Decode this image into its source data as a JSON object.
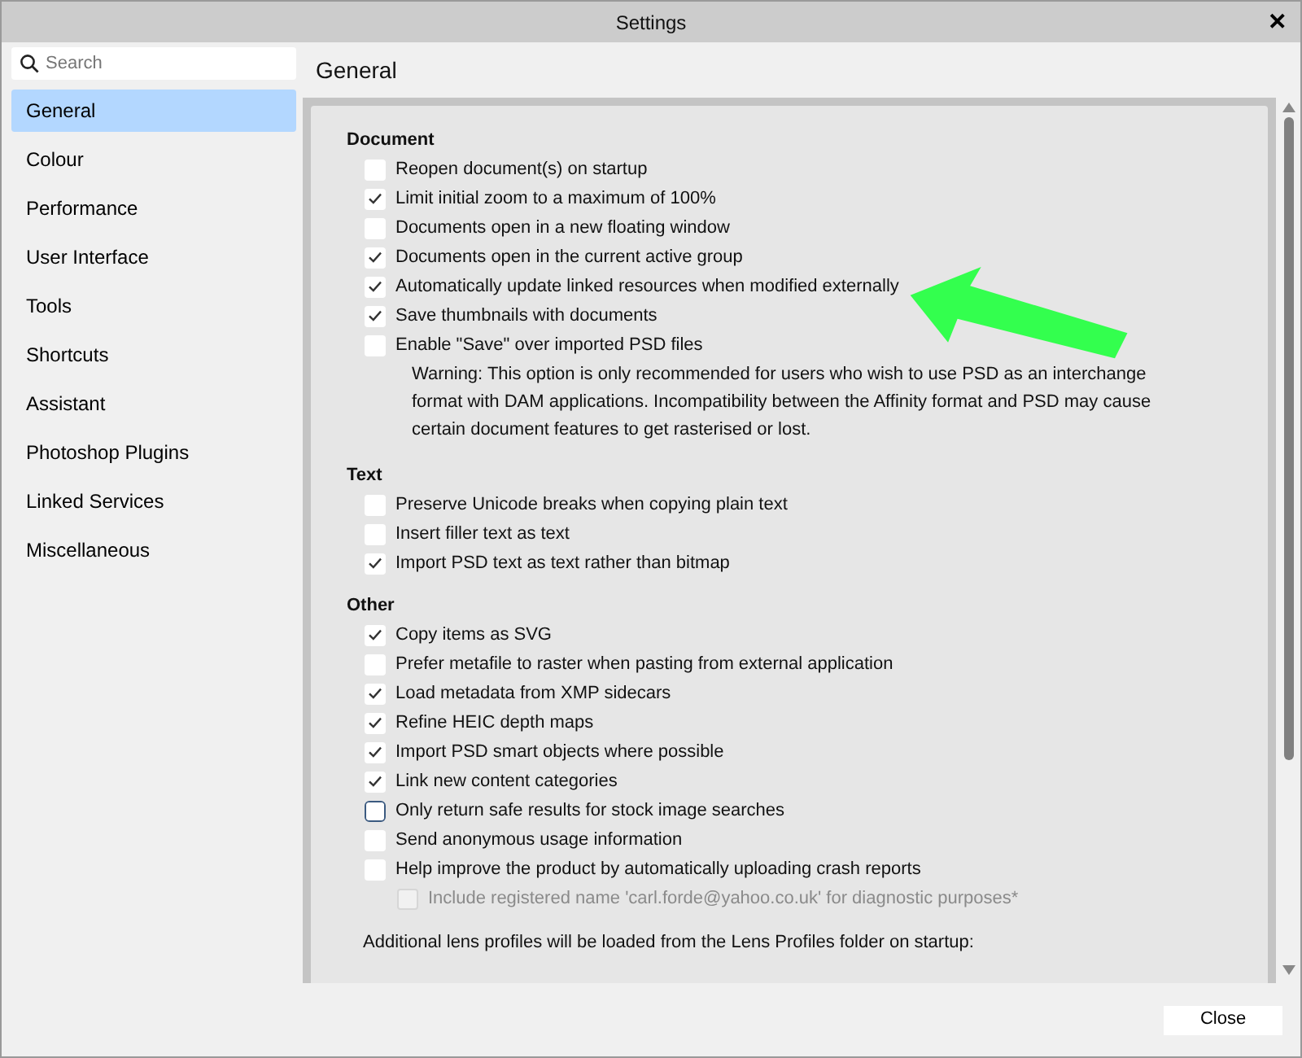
{
  "window": {
    "title": "Settings",
    "close_label": "✕"
  },
  "sidebar": {
    "search": {
      "placeholder": "Search"
    },
    "items": [
      {
        "label": "General",
        "selected": true
      },
      {
        "label": "Colour",
        "selected": false
      },
      {
        "label": "Performance",
        "selected": false
      },
      {
        "label": "User Interface",
        "selected": false
      },
      {
        "label": "Tools",
        "selected": false
      },
      {
        "label": "Shortcuts",
        "selected": false
      },
      {
        "label": "Assistant",
        "selected": false
      },
      {
        "label": "Photoshop Plugins",
        "selected": false
      },
      {
        "label": "Linked Services",
        "selected": false
      },
      {
        "label": "Miscellaneous",
        "selected": false
      }
    ]
  },
  "page": {
    "title": "General",
    "sections": [
      {
        "heading": "Document",
        "items": [
          {
            "kind": "checkbox",
            "label": "Reopen document(s) on startup",
            "checked": false
          },
          {
            "kind": "checkbox",
            "label": "Limit initial zoom to a maximum of 100%",
            "checked": true
          },
          {
            "kind": "checkbox",
            "label": "Documents open in a new floating window",
            "checked": false
          },
          {
            "kind": "checkbox",
            "label": "Documents open in the current active group",
            "checked": true
          },
          {
            "kind": "checkbox",
            "label": "Automatically update linked resources when modified externally",
            "checked": true
          },
          {
            "kind": "checkbox",
            "label": "Save thumbnails with documents",
            "checked": true
          },
          {
            "kind": "checkbox",
            "label": "Enable \"Save\" over imported PSD files",
            "checked": false
          },
          {
            "kind": "note",
            "label": "Warning: This option is only recommended for users who wish to use PSD as an interchange format with DAM applications. Incompatibility between the Affinity format and PSD may cause certain document features to get rasterised or lost."
          }
        ]
      },
      {
        "heading": "Text",
        "items": [
          {
            "kind": "checkbox",
            "label": "Preserve Unicode breaks when copying plain text",
            "checked": false
          },
          {
            "kind": "checkbox",
            "label": "Insert filler text as text",
            "checked": false
          },
          {
            "kind": "checkbox",
            "label": "Import PSD text as text rather than bitmap",
            "checked": true
          }
        ]
      },
      {
        "heading": "Other",
        "items": [
          {
            "kind": "checkbox",
            "label": "Copy items as SVG",
            "checked": true
          },
          {
            "kind": "checkbox",
            "label": "Prefer metafile to raster when pasting from external application",
            "checked": false
          },
          {
            "kind": "checkbox",
            "label": "Load metadata from XMP sidecars",
            "checked": true
          },
          {
            "kind": "checkbox",
            "label": "Refine HEIC depth maps",
            "checked": true
          },
          {
            "kind": "checkbox",
            "label": "Import PSD smart objects where possible",
            "checked": true
          },
          {
            "kind": "checkbox",
            "label": "Link new content categories",
            "checked": true
          },
          {
            "kind": "checkbox",
            "label": "Only return safe results for stock image searches",
            "checked": false,
            "focused": true
          },
          {
            "kind": "checkbox",
            "label": "Send anonymous usage information",
            "checked": false
          },
          {
            "kind": "checkbox",
            "label": "Help improve the product by automatically uploading crash reports",
            "checked": false,
            "children": [
              {
                "kind": "checkbox",
                "label": "Include registered name 'carl.forde@yahoo.co.uk' for diagnostic purposes*",
                "checked": false,
                "disabled": true
              }
            ]
          }
        ]
      }
    ],
    "footnote": "Additional lens profiles will be loaded from the Lens Profiles folder on startup:"
  },
  "footer": {
    "buttons": [
      "Close"
    ]
  }
}
